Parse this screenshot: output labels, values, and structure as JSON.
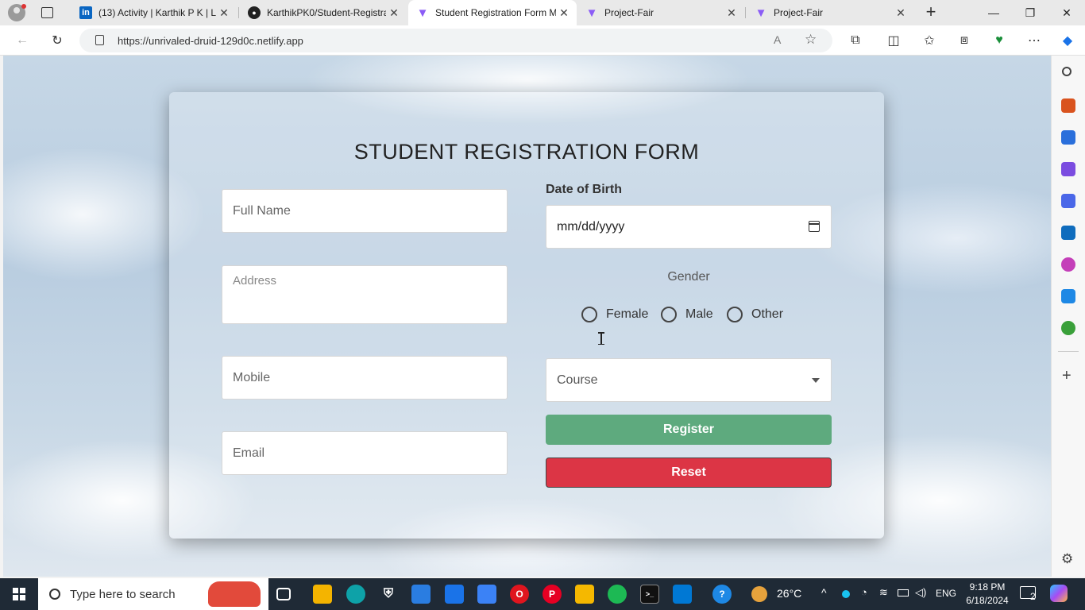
{
  "browser": {
    "tabs": [
      {
        "title": "(13) Activity | Karthik P K | Li",
        "icon": "linkedin-icon",
        "active": false
      },
      {
        "title": "KarthikPK0/Student-Registra",
        "icon": "github-icon",
        "active": false
      },
      {
        "title": "Student Registration Form M",
        "icon": "vite-icon",
        "active": true
      },
      {
        "title": "Project-Fair",
        "icon": "vite-icon",
        "active": false
      },
      {
        "title": "Project-Fair",
        "icon": "vite-icon",
        "active": false
      }
    ],
    "url": "https://unrivaled-druid-129d0c.netlify.app"
  },
  "form": {
    "title": "STUDENT REGISTRATION FORM",
    "full_name_placeholder": "Full Name",
    "address_placeholder": "Address",
    "mobile_placeholder": "Mobile",
    "email_placeholder": "Email",
    "dob_label": "Date of Birth",
    "dob_value": "mm/dd/yyyy",
    "gender_label": "Gender",
    "gender_options": [
      "Female",
      "Male",
      "Other"
    ],
    "course_placeholder": "Course",
    "register_label": "Register",
    "reset_label": "Reset"
  },
  "taskbar": {
    "search_placeholder": "Type here to search",
    "weather": "26°C",
    "language": "ENG",
    "time": "9:18 PM",
    "date": "6/18/2024",
    "notification_count": "2"
  },
  "colors": {
    "register": "#5eaa7e",
    "reset": "#dc3545",
    "taskbar": "#1f2a36"
  }
}
